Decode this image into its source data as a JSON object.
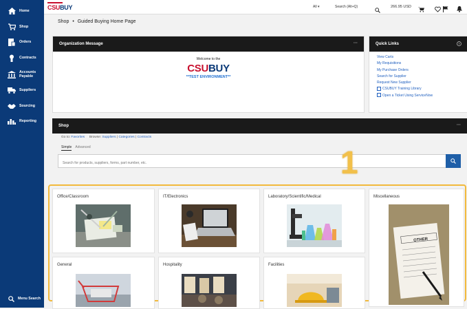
{
  "sidebar": {
    "items": [
      {
        "label": "Home",
        "icon": "home-icon"
      },
      {
        "label": "Shop",
        "icon": "cart-icon"
      },
      {
        "label": "Orders",
        "icon": "orders-icon"
      },
      {
        "label": "Contracts",
        "icon": "contracts-icon"
      },
      {
        "label": "Accounts Payable",
        "icon": "bank-icon"
      },
      {
        "label": "Suppliers",
        "icon": "suppliers-icon"
      },
      {
        "label": "Sourcing",
        "icon": "sourcing-icon"
      },
      {
        "label": "Reporting",
        "icon": "chart-icon"
      }
    ],
    "menu_search": "Menu Search"
  },
  "topbar": {
    "logo_csu": "CSU",
    "logo_buy": "BUY",
    "scope": "All ▾",
    "search_placeholder": "Search (Alt+Q)",
    "cart_total": "266.95 USD"
  },
  "breadcrumb": {
    "root": "Shop",
    "separator": "•",
    "current": "Guided Buying Home Page"
  },
  "org_message": {
    "title": "Organization Message",
    "welcome": "Welcome to the",
    "brand_csu": "CSU",
    "brand_buy": "BUY",
    "env": "**TEST ENVIRONMENT**"
  },
  "quick_links": {
    "title": "Quick Links",
    "items": [
      {
        "label": "View Carts",
        "external": false
      },
      {
        "label": "My Requisitions",
        "external": false
      },
      {
        "label": "My Purchase Orders",
        "external": false
      },
      {
        "label": "Search for Supplier",
        "external": false
      },
      {
        "label": "Request New Supplier",
        "external": false
      },
      {
        "label": "CSUBUY Training Library",
        "external": true
      },
      {
        "label": "Open a Ticket Using ServiceNow",
        "external": true
      }
    ]
  },
  "shop": {
    "title": "Shop",
    "goto_label": "Go to:",
    "favorites": "Favorites",
    "browse_label": "Browse:",
    "suppliers": "Suppliers",
    "sep": "|",
    "categories": "Categories",
    "contracts": "Contracts",
    "tab_simple": "Simple",
    "tab_advanced": "Advanced",
    "search_placeholder": "Search for products, suppliers, forms, part number, etc."
  },
  "callout": "1",
  "categories": [
    {
      "name": "Office/Classroom"
    },
    {
      "name": "IT/Electronics"
    },
    {
      "name": "Laboratory/Scientific/Medical"
    },
    {
      "name": "Miscellaneous"
    },
    {
      "name": "General"
    },
    {
      "name": "Hospitality"
    },
    {
      "name": "Facilities"
    }
  ],
  "other_sign": "OTHER",
  "colors": {
    "nav": "#0b3a78",
    "accent": "#1f5fa8",
    "brand_red": "#c8102e",
    "highlight": "#f2b93b"
  }
}
